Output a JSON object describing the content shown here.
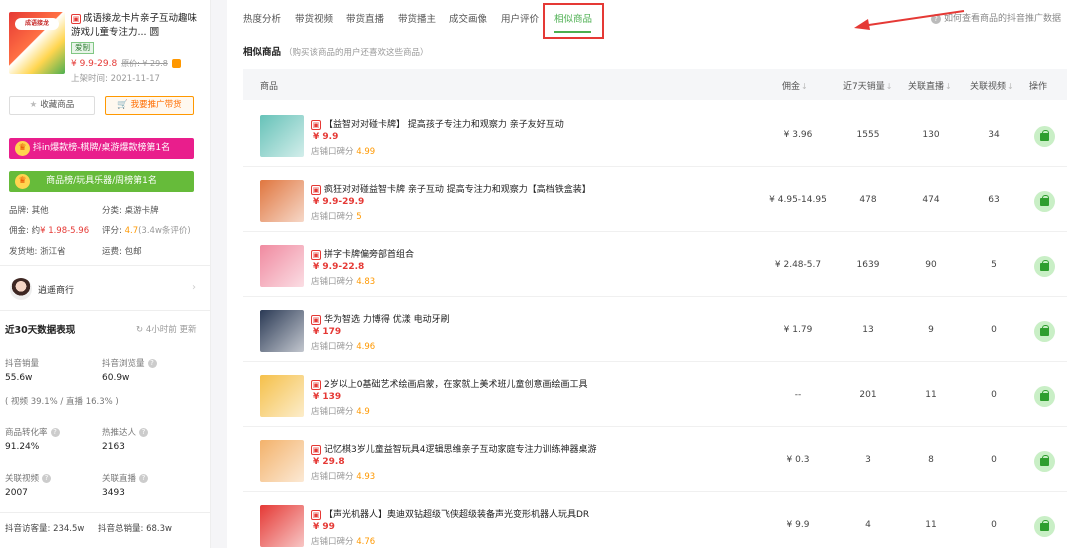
{
  "product": {
    "title": "成语接龙卡片亲子互动趣味游戏儿童专注力... 圆",
    "thumb_text": "成语接龙",
    "tag": "爱制",
    "price": "¥ 9.9-29.8",
    "orig_price": "原价: ¥ 29.8",
    "listed": "上架时间:  2021-11-17"
  },
  "buttons": {
    "favorite": "收藏商品",
    "promote": "我要推广带货"
  },
  "ranks": {
    "r1": "抖in爆款榜-棋牌/桌游爆款榜第1名",
    "r2": "商品榜/玩具乐器/周榜第1名"
  },
  "attrs": {
    "brand_label": "品牌: 其他",
    "category_label": "分类:  桌游卡牌",
    "commission_label": "佣金: 约",
    "commission_value": "¥ 1.98-5.96",
    "rating_label": "评分:",
    "rating_value": "4.7",
    "rating_count": "(3.4w条评价)",
    "origin_label": "发货地: 浙江省",
    "shipping_label": "运费:  包邮"
  },
  "shop": {
    "name": "逍遥商行"
  },
  "stats": {
    "title": "近30天数据表现",
    "refresh": "4小时前 更新",
    "douyin_sales_label": "抖音销量",
    "douyin_sales": "55.6w",
    "douyin_views_label": "抖音浏览量",
    "douyin_views": "60.9w",
    "split": "( 视频 39.1% /  直播 16.3% )",
    "conv_label": "商品转化率",
    "conv": "91.24%",
    "influencers_label": "热推达人",
    "influencers": "2163",
    "videos_label": "关联视频",
    "videos": "2007",
    "lives_label": "关联直播",
    "lives": "3493",
    "footer_visitors": "抖音访客量:  234.5w",
    "footer_sales": "抖音总销量:  68.3w"
  },
  "tabs": [
    "热度分析",
    "带货视频",
    "带货直播",
    "带货播主",
    "成交画像",
    "用户评价",
    "相似商品"
  ],
  "help_link": "如何查看商品的抖音推广数据",
  "section": {
    "title": "相似商品",
    "hint": "（购买该商品的用户还喜欢这些商品）"
  },
  "columns": [
    "商品",
    "佣金",
    "近7天销量",
    "关联直播",
    "关联视频",
    "操作"
  ],
  "rows": [
    {
      "name": "【益智对对碰卡牌】 提高孩子专注力和观察力 亲子友好互动",
      "price": "¥ 9.9",
      "score_label": "店铺口碑分",
      "score": "4.99",
      "commission": "¥ 3.96",
      "sales7": "1555",
      "lives": "130",
      "videos": "34",
      "img_color": "#66c2b8"
    },
    {
      "name": "疯狂对对碰益智卡牌 亲子互动 提高专注力和观察力【高档铁盒装】",
      "price": "¥ 9.9-29.9",
      "score_label": "店铺口碑分",
      "score": "5",
      "commission": "¥ 4.95-14.95",
      "sales7": "478",
      "lives": "474",
      "videos": "63",
      "img_color": "#e0763f"
    },
    {
      "name": "拼字卡牌偏旁部首组合",
      "price": "¥ 9.9-22.8",
      "score_label": "店铺口碑分",
      "score": "4.83",
      "commission": "¥ 2.48-5.7",
      "sales7": "1639",
      "lives": "90",
      "videos": "5",
      "img_color": "#f08aa0"
    },
    {
      "name": "华为智选 力博得 优漾 电动牙刷",
      "price": "¥ 179",
      "score_label": "店铺口碑分",
      "score": "4.96",
      "commission": "¥ 1.79",
      "sales7": "13",
      "lives": "9",
      "videos": "0",
      "img_color": "#2b3a55"
    },
    {
      "name": "2岁以上0基础艺术绘画启蒙，在家就上美术班儿童创意画绘画工具",
      "price": "¥ 139",
      "score_label": "店铺口碑分",
      "score": "4.9",
      "commission": "--",
      "sales7": "201",
      "lives": "11",
      "videos": "0",
      "img_color": "#f5c04a"
    },
    {
      "name": "记忆棋3岁儿童益智玩具4逻辑思维亲子互动家庭专注力训练神器桌游",
      "price": "¥ 29.8",
      "score_label": "店铺口碑分",
      "score": "4.93",
      "commission": "¥ 0.3",
      "sales7": "3",
      "lives": "8",
      "videos": "0",
      "img_color": "#f3b26b"
    },
    {
      "name": "【声光机器人】奥迪双钻超级飞侠超级装备声光变形机器人玩具DR",
      "price": "¥ 99",
      "score_label": "店铺口碑分",
      "score": "4.76",
      "commission": "¥ 9.9",
      "sales7": "4",
      "lives": "11",
      "videos": "0",
      "img_color": "#e53935"
    }
  ]
}
